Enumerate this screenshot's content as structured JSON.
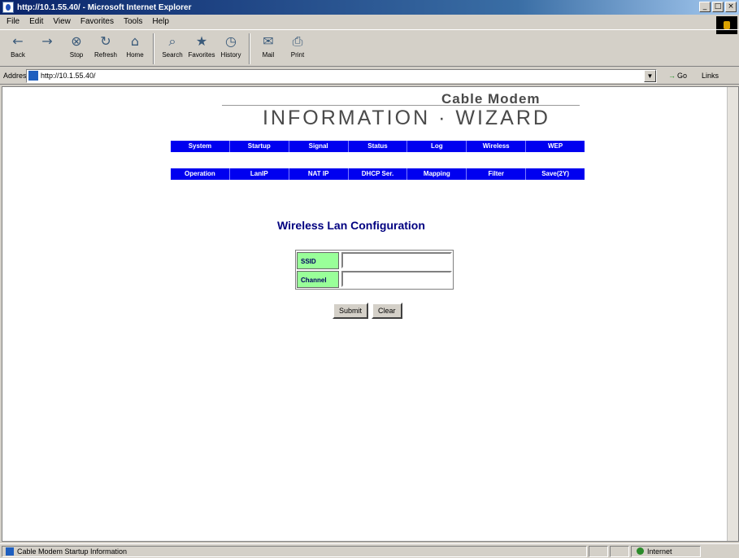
{
  "window": {
    "title": "http://10.1.55.40/ - Microsoft Internet Explorer",
    "controls": [
      "_",
      "□",
      "×"
    ]
  },
  "menu": [
    "File",
    "Edit",
    "View",
    "Favorites",
    "Tools",
    "Help"
  ],
  "toolbar": {
    "buttons": [
      {
        "icon": "back-arrow-icon",
        "glyph": "←",
        "label": "Back"
      },
      {
        "icon": "forward-arrow-icon",
        "glyph": "→",
        "label": ""
      },
      {
        "icon": "stop-icon",
        "glyph": "⊗",
        "label": "Stop"
      },
      {
        "icon": "refresh-icon",
        "glyph": "↻",
        "label": "Refresh"
      },
      {
        "icon": "home-icon",
        "glyph": "⌂",
        "label": "Home"
      },
      {
        "icon": "search-icon",
        "glyph": "⌕",
        "label": "Search"
      },
      {
        "icon": "favorites-icon",
        "glyph": "★",
        "label": "Favorites"
      },
      {
        "icon": "history-icon",
        "glyph": "◷",
        "label": "History"
      },
      {
        "icon": "mail-icon",
        "glyph": "✉",
        "label": "Mail"
      },
      {
        "icon": "print-icon",
        "glyph": "⎙",
        "label": "Print"
      }
    ]
  },
  "address": {
    "label": "Address",
    "url": "http://10.1.55.40/",
    "go_label": "Go",
    "links_label": "Links"
  },
  "brand": {
    "sub": "Cable Modem",
    "main": "INFORMATION · WIZARD"
  },
  "nav": {
    "row1": [
      "System",
      "Startup",
      "Signal",
      "Status",
      "Log",
      "Wireless",
      "WEP"
    ],
    "row2": [
      "Operation",
      "LanIP",
      "NAT IP",
      "DHCP Ser.",
      "Mapping",
      "Filter",
      "Save(2Y)"
    ]
  },
  "form": {
    "title": "Wireless Lan Configuration",
    "fields": [
      {
        "label": "SSID",
        "value": ""
      },
      {
        "label": "Channel",
        "value": ""
      }
    ],
    "submit_label": "Submit",
    "clear_label": "Clear"
  },
  "status": {
    "text": "Cable Modem Startup Information",
    "zone": "Internet"
  },
  "colors": {
    "nav_bg": "#0000f0",
    "label_bg": "#99ff99",
    "title_color": "#000080",
    "titlebar": "#0a246a"
  }
}
